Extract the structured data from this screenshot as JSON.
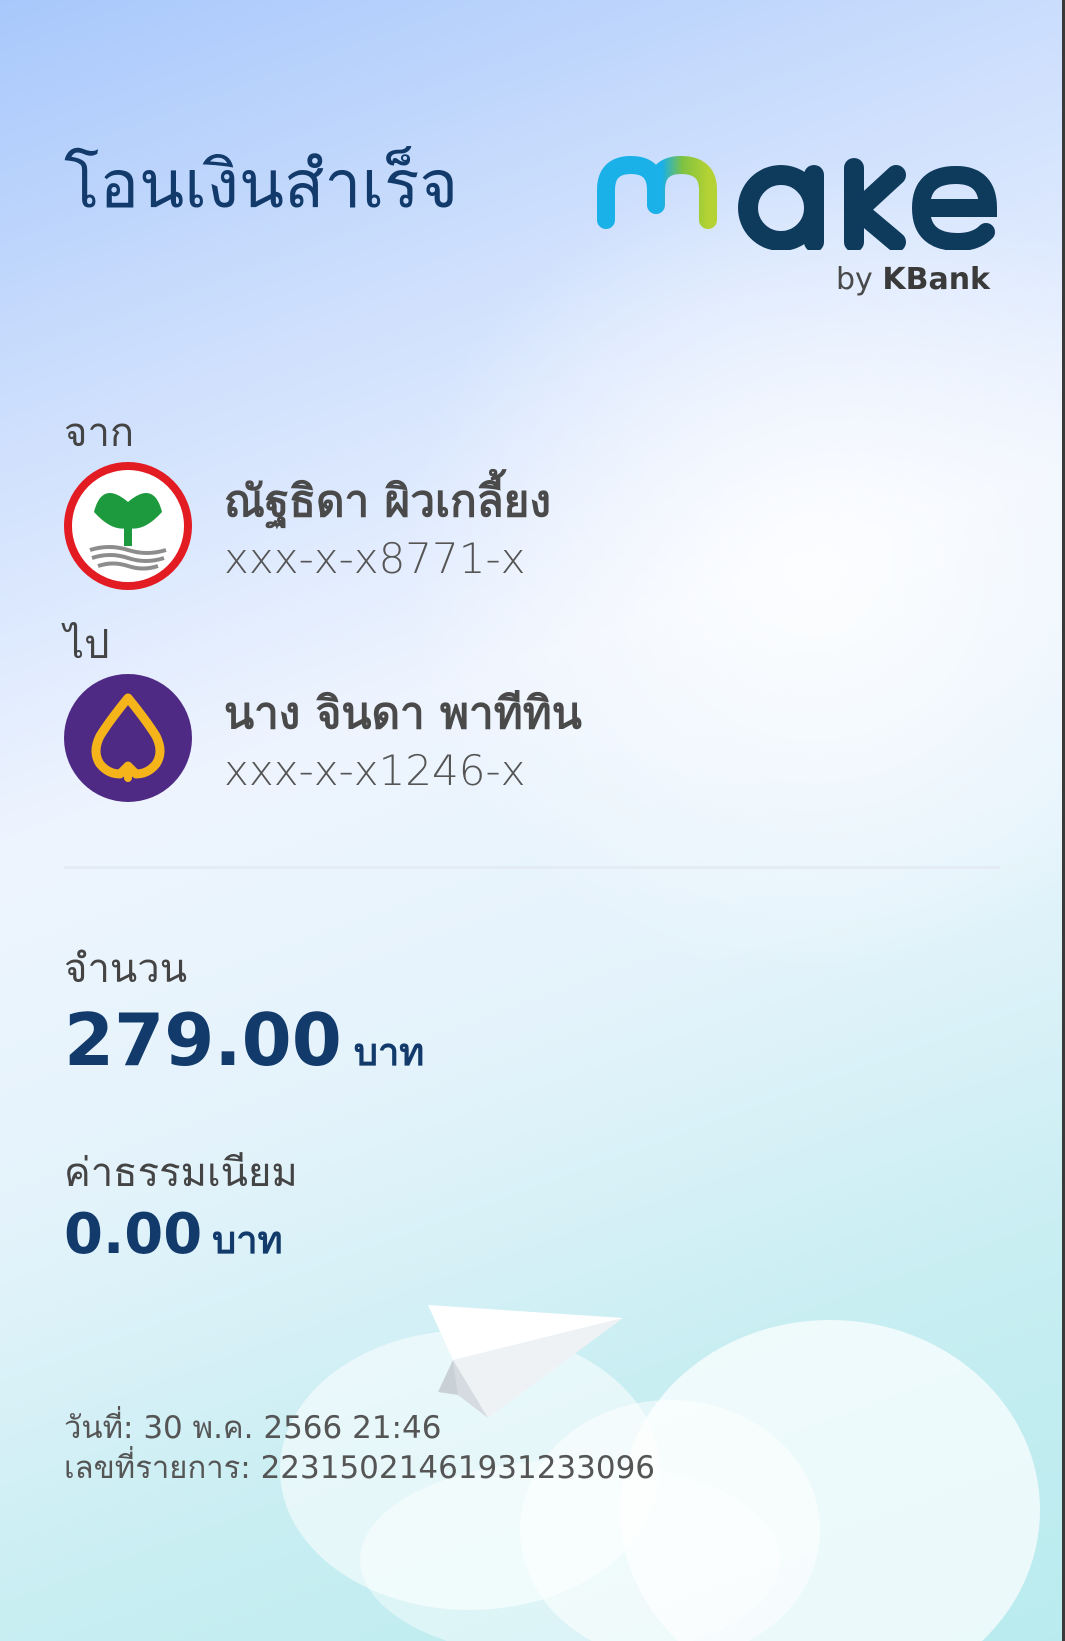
{
  "header": {
    "title": "โอนเงินสำเร็จ",
    "logo_by_prefix": "by ",
    "logo_by_brand": "KBank"
  },
  "from": {
    "label": "จาก",
    "name": "ณัฐธิดา ผิวเกลี้ยง",
    "account": "xxx-x-x8771-x",
    "bank_icon": "kbank-logo-icon"
  },
  "to": {
    "label": "ไป",
    "name": "นาง จินดา พาทีทิน",
    "account": "xxx-x-x1246-x",
    "bank_icon": "scb-logo-icon"
  },
  "amount": {
    "label": "จำนวน",
    "value": "279.00",
    "unit": "บาท"
  },
  "fee": {
    "label": "ค่าธรรมเนียม",
    "value": "0.00",
    "unit": "บาท"
  },
  "footer": {
    "date": "วันที่: 30 พ.ค. 2566 21:46",
    "ref": "เลขที่รายการ: 223150214619312330​96"
  },
  "colors": {
    "primary_text": "#123b6b",
    "kbank_green": "#1d9a3d",
    "kbank_red": "#e31b23",
    "scb_purple": "#4e2a84",
    "scb_gold": "#f4b41a"
  }
}
